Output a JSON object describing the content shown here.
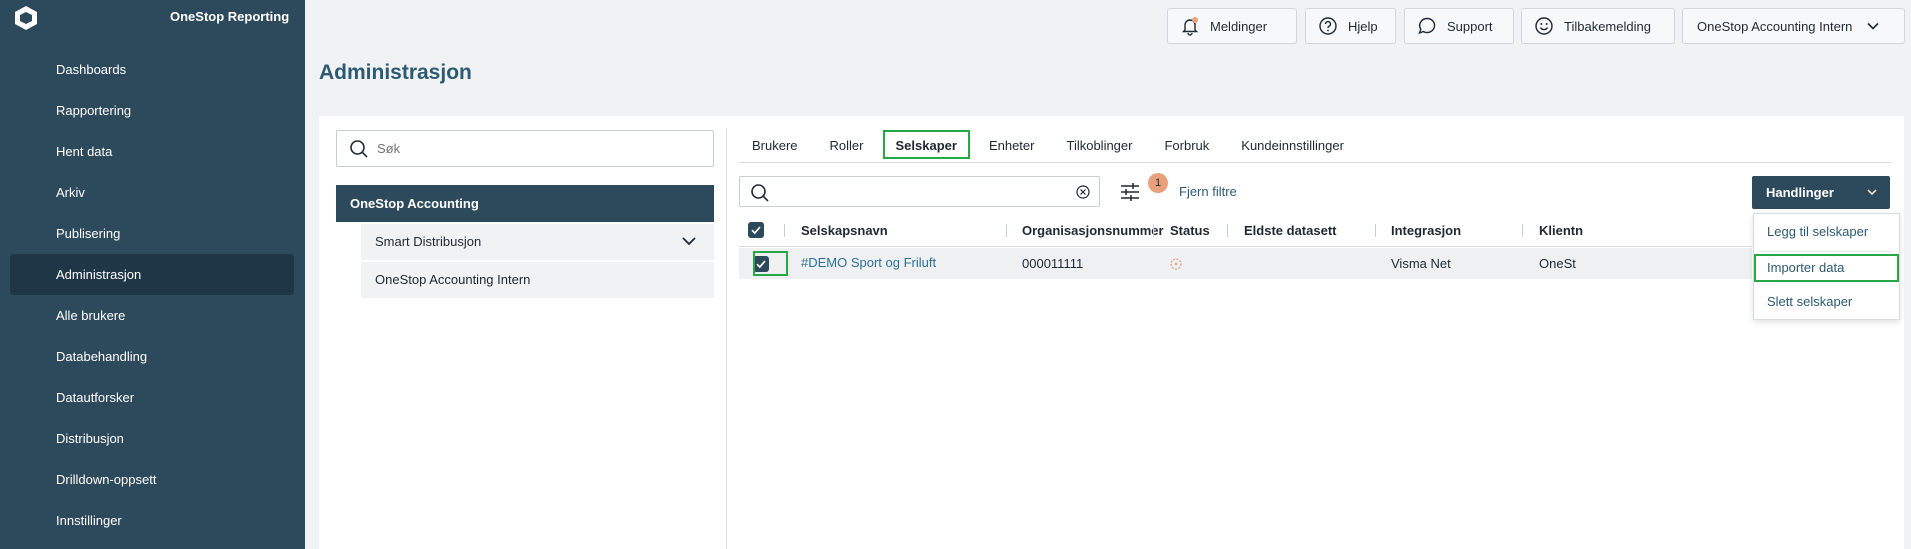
{
  "app": {
    "brand": "OneStop Reporting"
  },
  "sidebar": {
    "items": [
      {
        "label": "Dashboards",
        "active": false
      },
      {
        "label": "Rapportering",
        "active": false
      },
      {
        "label": "Hent data",
        "active": false
      },
      {
        "label": "Arkiv",
        "active": false
      },
      {
        "label": "Publisering",
        "active": false
      },
      {
        "label": "Administrasjon",
        "active": true
      },
      {
        "label": "Alle brukere",
        "active": false
      },
      {
        "label": "Databehandling",
        "active": false
      },
      {
        "label": "Datautforsker",
        "active": false
      },
      {
        "label": "Distribusjon",
        "active": false
      },
      {
        "label": "Drilldown-oppsett",
        "active": false
      },
      {
        "label": "Innstillinger",
        "active": false
      }
    ]
  },
  "topbar": {
    "messages": "Meldinger",
    "help": "Hjelp",
    "support": "Support",
    "feedback": "Tilbakemelding",
    "account": "OneStop Accounting Intern"
  },
  "page": {
    "title": "Administrasjon"
  },
  "left": {
    "search_placeholder": "Søk",
    "org_main": "OneStop Accounting",
    "org_subs": [
      "Smart Distribusjon",
      "OneStop Accounting Intern"
    ]
  },
  "tabs": [
    {
      "label": "Brukere",
      "active": false
    },
    {
      "label": "Roller",
      "active": false
    },
    {
      "label": "Selskaper",
      "active": true
    },
    {
      "label": "Enheter",
      "active": false
    },
    {
      "label": "Tilkoblinger",
      "active": false
    },
    {
      "label": "Forbruk",
      "active": false
    },
    {
      "label": "Kundeinnstillinger",
      "active": false
    }
  ],
  "toolbar": {
    "filter_count": "1",
    "clear_filters": "Fjern filtre",
    "actions": "Handlinger"
  },
  "table": {
    "columns": [
      "Selskapsnavn",
      "Organisasjonsnummer",
      "Status",
      "Eldste datasett",
      "Integrasjon",
      "Klientn"
    ],
    "rows": [
      {
        "name": "#DEMO Sport og Friluft",
        "orgnr": "000011111",
        "status": "",
        "oldest": "",
        "integration": "Visma Net",
        "client": "OneSt"
      }
    ]
  },
  "actions_menu": [
    "Legg til selskaper",
    "Importer data",
    "Slett selskaper"
  ],
  "colors": {
    "sidebar": "#2d4a5c",
    "accent": "#28a745",
    "link": "#2d6f9a",
    "badge": "#e8a07a"
  }
}
